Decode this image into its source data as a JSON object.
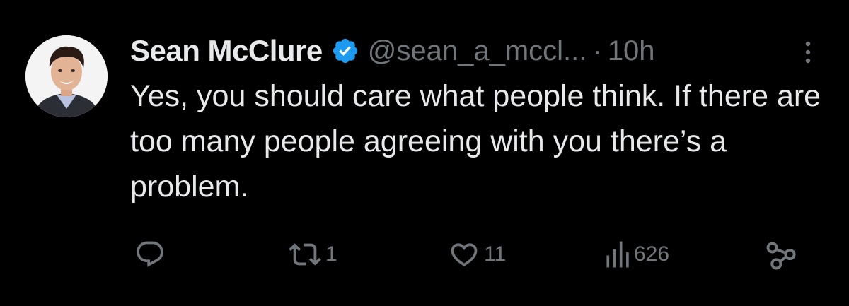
{
  "tweet": {
    "author_name": "Sean McClure",
    "handle": "@sean_a_mccl...",
    "separator": "·",
    "time": "10h",
    "text": "Yes, you should care what people think. If there are too many people agreeing with you there’s a problem.",
    "verified_color": "#1d9bf0"
  },
  "actions": {
    "reply_icon": "reply-icon",
    "retweet_count": "1",
    "like_count": "11",
    "views_count": "626",
    "share_icon": "share-icon"
  },
  "colors": {
    "background": "#000000",
    "primary_text": "#e7e9ea",
    "secondary_text": "#71767b"
  }
}
